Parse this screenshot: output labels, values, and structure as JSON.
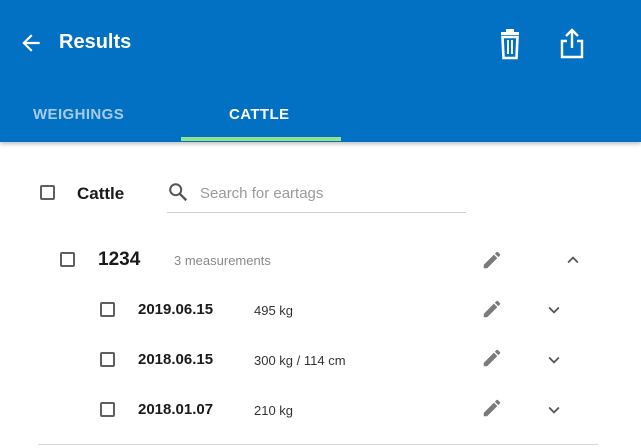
{
  "header": {
    "title": "Results"
  },
  "tabs": [
    {
      "label": "WEIGHINGS",
      "active": false
    },
    {
      "label": "CATTLE",
      "active": true
    }
  ],
  "list_header": {
    "label": "Cattle",
    "search_placeholder": "Search for eartags"
  },
  "group": {
    "eartag": "1234",
    "count_text": "3 measurements",
    "expanded": true,
    "rows": [
      {
        "date": "2019.06.15",
        "value": "495 kg"
      },
      {
        "date": "2018.06.15",
        "value": "300 kg / 114 cm"
      },
      {
        "date": "2018.01.07",
        "value": "210 kg"
      }
    ]
  },
  "colors": {
    "appbar": "#0271c3",
    "tab_indicator": "#8fe38a",
    "inactive_tab": "#a8cbe9"
  },
  "icons": {
    "back": "arrow-left",
    "delete": "trash",
    "share": "share-upload",
    "search": "magnifier",
    "edit": "pencil",
    "expand": "chevron-down",
    "collapse": "chevron-up"
  }
}
